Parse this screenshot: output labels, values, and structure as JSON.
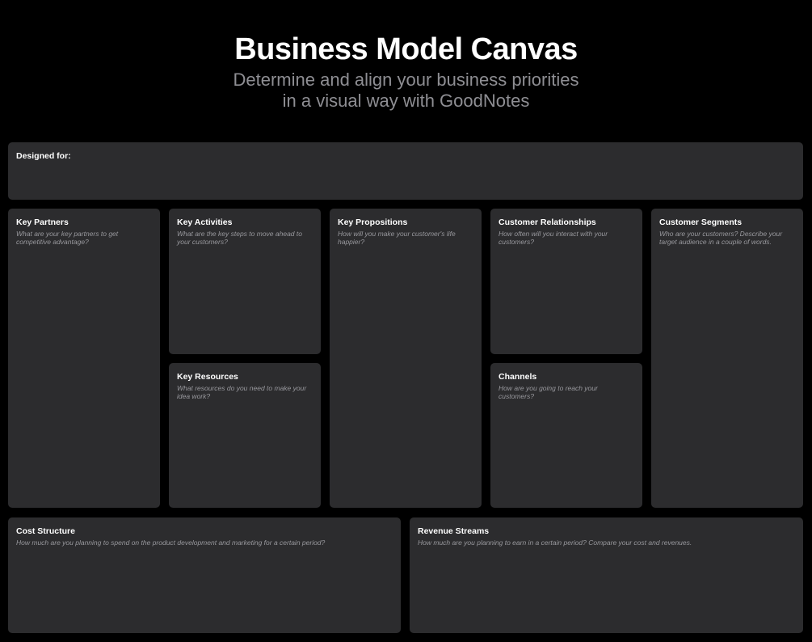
{
  "header": {
    "title": "Business Model Canvas",
    "subtitle_line1": "Determine and align your business priorities",
    "subtitle_line2": "in a visual way with GoodNotes"
  },
  "designed_for": {
    "title": "Designed for:"
  },
  "key_partners": {
    "title": "Key Partners",
    "description": "What are your key partners to get competitive advantage?"
  },
  "key_activities": {
    "title": "Key Activities",
    "description": "What are the key steps to move ahead to your customers?"
  },
  "key_resources": {
    "title": "Key Resources",
    "description": "What resources do you need to make your idea work?"
  },
  "key_propositions": {
    "title": "Key Propositions",
    "description": "How will you make your customer's life happier?"
  },
  "customer_relationships": {
    "title": "Customer Relationships",
    "description": "How often will you interact with your customers?"
  },
  "channels": {
    "title": "Channels",
    "description": "How are you going to reach your customers?"
  },
  "customer_segments": {
    "title": "Customer Segments",
    "description": "Who are your customers? Describe your target audience in a couple of words."
  },
  "cost_structure": {
    "title": "Cost Structure",
    "description": "How much are you planning to spend on the product development and marketing for a certain period?"
  },
  "revenue_streams": {
    "title": "Revenue Streams",
    "description": "How much are you planning to earn in a certain period? Compare your cost and revenues."
  },
  "colors": {
    "background": "#000000",
    "card": "#2c2c2e",
    "title_text": "#ffffff",
    "subtitle_text": "#8e8e93",
    "description_text": "#98989d"
  }
}
